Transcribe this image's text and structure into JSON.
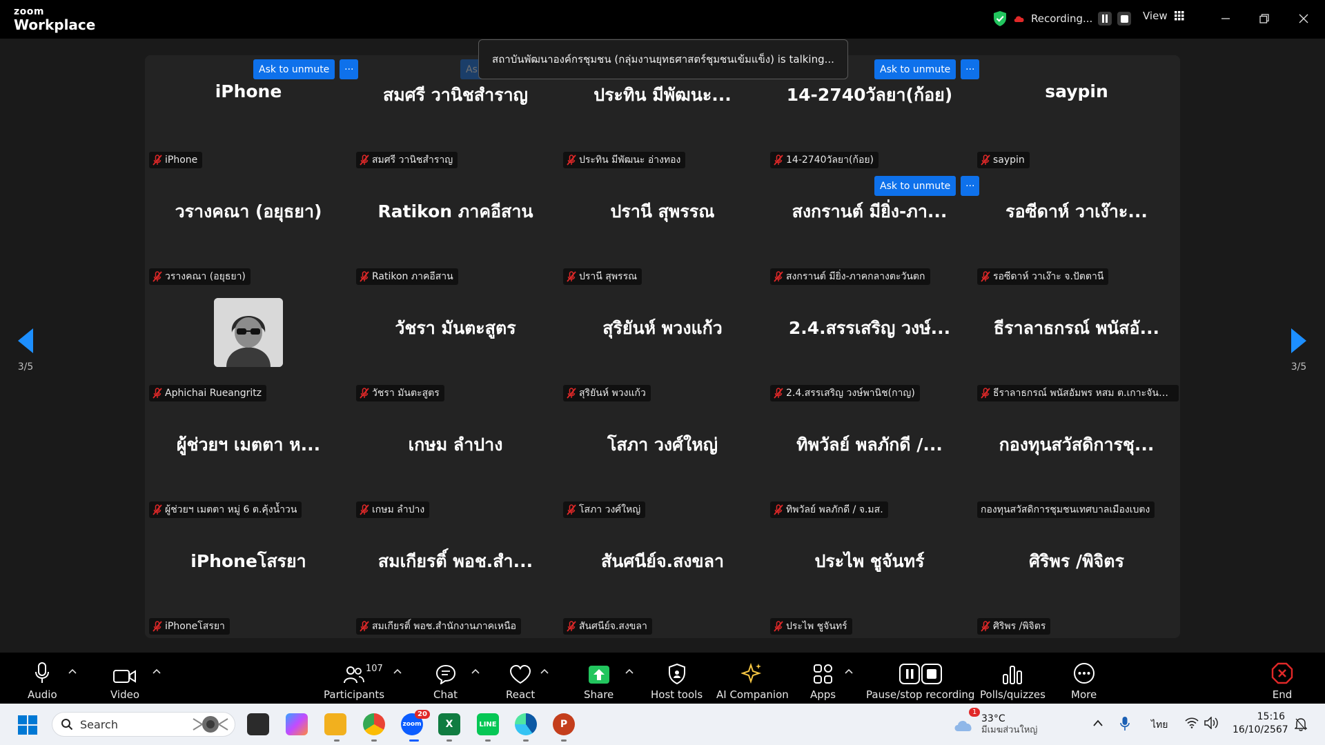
{
  "app": {
    "brand_small": "zoom",
    "brand_big": "Workplace"
  },
  "titlebar": {
    "recording_label": "Recording...",
    "view_label": "View"
  },
  "banner": {
    "talking_text": "สถาบันพัฒนาองค์กรชุมชน (กลุ่มงานยุทธศาสตร์ชุมชนเข้มแข็ง) is talking..."
  },
  "unmute": {
    "label": "Ask to unmute",
    "more": "···"
  },
  "pages": {
    "left": "3/5",
    "right": "3/5"
  },
  "tiles": [
    {
      "display": "iPhone",
      "tag": "iPhone",
      "muted": true
    },
    {
      "display": "สมศรี  วานิชสำราญ",
      "tag": "สมศรี  วานิชสำราญ",
      "muted": true
    },
    {
      "display": "ประทิน มีพัฒนะ...",
      "tag": "ประทิน มีพัฒนะ  อ่างทอง",
      "muted": true
    },
    {
      "display": "14-2740วัลยา(ก้อย)",
      "tag": "14-2740วัลยา(ก้อย)",
      "muted": true
    },
    {
      "display": "saypin",
      "tag": "saypin",
      "muted": true
    },
    {
      "display": "วรางคณา (อยุธยา)",
      "tag": "วรางคณา (อยุธยา)",
      "muted": true
    },
    {
      "display": "Ratikon ภาคอีสาน",
      "tag": "Ratikon ภาคอีสาน",
      "muted": true
    },
    {
      "display": "ปรานี สุพรรณ",
      "tag": "ปรานี สุพรรณ",
      "muted": true
    },
    {
      "display": "สงกรานต์ มียิ่ง-ภา...",
      "tag": "สงกรานต์ มียิ่ง-ภาคกลางตะวันตก",
      "muted": true
    },
    {
      "display": "รอซีดาห์   วาเง๊าะ...",
      "tag": "รอซีดาห์   วาเง๊าะ  จ.ปัตตานี",
      "muted": true
    },
    {
      "display": "",
      "tag": "Aphichai Rueangritz",
      "muted": true,
      "avatar": true
    },
    {
      "display": "วัชรา มันตะสูตร",
      "tag": "วัชรา มันตะสูตร",
      "muted": true
    },
    {
      "display": "สุริยันห์ พวงแก้ว",
      "tag": "สุริยันห์ พวงแก้ว",
      "muted": true
    },
    {
      "display": "2.4.สรรเสริญ วงษ์...",
      "tag": "2.4.สรรเสริญ วงษ์พานิช(กาญ)",
      "muted": true
    },
    {
      "display": "ธีราลาธกรณ์ พนัสอั...",
      "tag": "ธีราลาธกรณ์ พนัสอัมพร หสม ต.เกาะจันทร์ /...",
      "muted": true
    },
    {
      "display": "ผู้ช่วยฯ เมตตา  ห...",
      "tag": "ผู้ช่วยฯ เมตตา  หมู่ 6 ต.คุ้งน้ำวน",
      "muted": true
    },
    {
      "display": "เกษม ลำปาง",
      "tag": "เกษม ลำปาง",
      "muted": true
    },
    {
      "display": "โสภา วงศ์ใหญ่",
      "tag": "โสภา วงศ์ใหญ่",
      "muted": true
    },
    {
      "display": "ทิพวัลย์  พลภักดี /...",
      "tag": "ทิพวัลย์  พลภักดี / จ.มส.",
      "muted": true
    },
    {
      "display": "กองทุนสวัสดิการชุ...",
      "tag": "กองทุนสวัสดิการชุมชนเทศบาลเมืองเบตง",
      "muted": false
    },
    {
      "display": "iPhoneโสรยา",
      "tag": "iPhoneโสรยา",
      "muted": true
    },
    {
      "display": "สมเกียรติ์ พอช.สำ...",
      "tag": "สมเกียรติ์ พอช.สำนักงานภาคเหนือ",
      "muted": true
    },
    {
      "display": "สันศนีย์จ.สงขลา",
      "tag": "สันศนีย์จ.สงขลา",
      "muted": true
    },
    {
      "display": "ประไพ ชูจันทร์",
      "tag": "ประไพ ชูจันทร์",
      "muted": true
    },
    {
      "display": "ศิริพร /พิจิตร",
      "tag": "ศิริพร /พิจิตร",
      "muted": true
    }
  ],
  "toolbar": {
    "audio": "Audio",
    "video": "Video",
    "participants": "Participants",
    "participants_count": "107",
    "chat": "Chat",
    "react": "React",
    "share": "Share",
    "host_tools": "Host tools",
    "ai_companion": "AI Companion",
    "apps": "Apps",
    "pause_stop": "Pause/stop recording",
    "polls": "Polls/quizzes",
    "more": "More",
    "end": "End"
  },
  "taskbar": {
    "search_placeholder": "Search",
    "zoom_badge": "20",
    "weather_temp": "33°C",
    "weather_desc": "มีเมฆส่วนใหญ่",
    "weather_badge": "1",
    "lang": "ไทย",
    "time": "15:16",
    "date": "16/10/2567"
  },
  "colors": {
    "accent": "#0e71eb",
    "mute_red": "#e02828",
    "share_green": "#22c55e",
    "end_red": "#e02828"
  }
}
